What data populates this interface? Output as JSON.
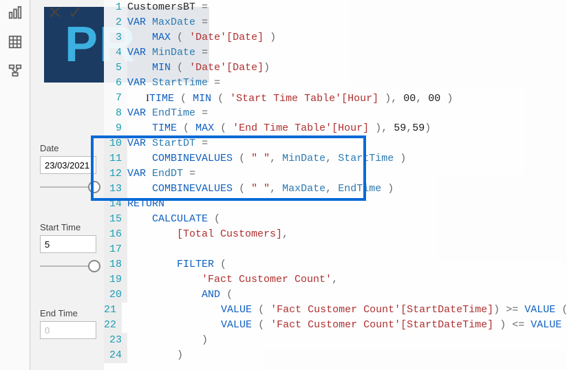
{
  "watermark": "PR",
  "rail": {
    "chart": "bar-chart",
    "table": "table",
    "model": "model"
  },
  "controls": {
    "cancel": "✕",
    "commit": "✓"
  },
  "fields": {
    "date_label": "Date",
    "date_value": "23/03/2021",
    "start_time_label": "Start Time",
    "start_time_value": "5",
    "end_time_label": "End Time",
    "end_time_value": "0"
  },
  "code": {
    "l1": "CustomersBT =",
    "l2": "VAR MaxDate =",
    "l3": "    MAX ( 'Date'[Date] )",
    "l4": "VAR MinDate =",
    "l5": "    MIN ( 'Date'[Date])",
    "l6": "VAR StartTime =",
    "l7": "    TIME ( MIN ( 'Start Time Table'[Hour] ), 00, 00 )",
    "l8": "VAR EndTime =",
    "l9": "    TIME ( MAX ( 'End Time Table'[Hour] ), 59,59)",
    "l10": "VAR StartDT =",
    "l11": "    COMBINEVALUES ( \" \", MinDate, StartTime )",
    "l12": "VAR EndDT =",
    "l13": "    COMBINEVALUES ( \" \", MaxDate, EndTime )",
    "l14": "RETURN",
    "l15": "    CALCULATE (",
    "l16": "        [Total Customers],",
    "l17": "",
    "l18": "        FILTER (",
    "l19": "            'Fact Customer Count',",
    "l20": "            AND (",
    "l21": "                VALUE ( 'Fact Customer Count'[StartDateTime]) >= VALUE ( StartDT ),",
    "l22": "                VALUE ( 'Fact Customer Count'[StartDateTime] ) <= VALUE ( EndDT )",
    "l23": "            )",
    "l24": "        )"
  },
  "tokens": {
    "VAR": "VAR",
    "RETURN": "RETURN",
    "MAX": "MAX",
    "MIN": "MIN",
    "TIME": "TIME",
    "COMBINEVALUES": "COMBINEVALUES",
    "CALCULATE": "CALCULATE",
    "FILTER": "FILTER",
    "AND": "AND",
    "VALUE": "VALUE",
    "CustomersBT": "CustomersBT",
    "MaxDate": "MaxDate",
    "MinDate": "MinDate",
    "StartTime": "StartTime",
    "EndTime": "EndTime",
    "StartDT": "StartDT",
    "EndDT": "EndDT",
    "DateTbl": "'Date'",
    "DateCol": "[Date]",
    "STT": "'Start Time Table'",
    "ETT": "'End Time Table'",
    "Hour": "[Hour]",
    "Fact": "'Fact Customer Count'",
    "SDT": "[StartDateTime]",
    "TotCust": "[Total Customers]",
    "strSpace": "\" \""
  }
}
